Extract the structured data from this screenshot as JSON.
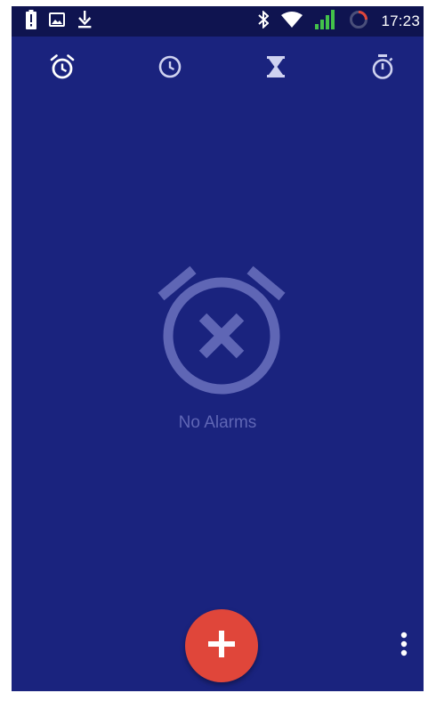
{
  "status_bar": {
    "time": "17:23",
    "left_icons": [
      "battery-alert-icon",
      "image-icon",
      "download-icon"
    ],
    "right_icons": [
      "bluetooth-icon",
      "wifi-icon",
      "cell-signal-icon",
      "sync-progress-icon"
    ]
  },
  "tabs": [
    {
      "name": "alarm",
      "icon": "alarm-clock-icon",
      "selected": true
    },
    {
      "name": "clock",
      "icon": "clock-icon",
      "selected": false
    },
    {
      "name": "timer",
      "icon": "hourglass-icon",
      "selected": false
    },
    {
      "name": "stopwatch",
      "icon": "stopwatch-icon",
      "selected": false
    }
  ],
  "empty_state": {
    "icon": "alarm-off-icon",
    "label": "No Alarms"
  },
  "fab": {
    "icon": "add-icon"
  },
  "overflow_menu": {
    "icon": "more-vert-icon"
  },
  "colors": {
    "background": "#1a237e",
    "status_bar": "#0f1450",
    "fab": "#e0463a",
    "muted_art": "#5f66b5",
    "signal_green": "#43c34a"
  }
}
